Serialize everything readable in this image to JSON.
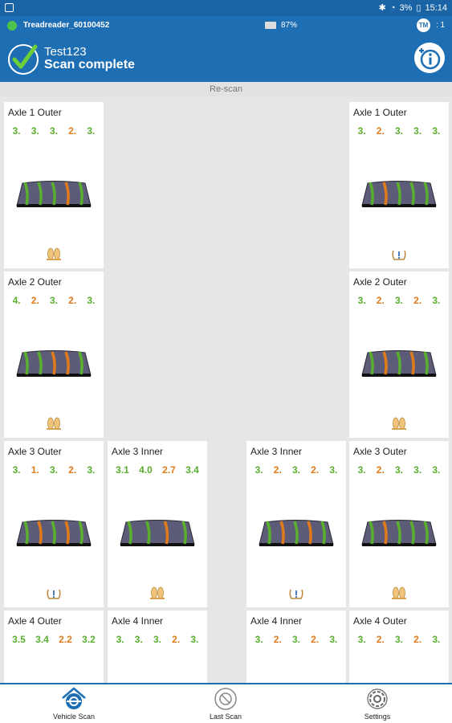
{
  "statusbar": {
    "battery": "3%",
    "time": "15:14"
  },
  "device": {
    "name": "Treadreader_60100452",
    "battery": "87%",
    "tm_badge": "TM",
    "tm_count": ": 1"
  },
  "header": {
    "subtitle": "Test123",
    "title": "Scan complete"
  },
  "rescan_label": "Re-scan",
  "colors": {
    "primary": "#1e6eb4",
    "good": "#5aae2e",
    "warn": "#e07a1a"
  },
  "tires": [
    {
      "label": "Axle 1 Outer",
      "depths": [
        {
          "v": "3.",
          "c": "g"
        },
        {
          "v": "3.",
          "c": "g"
        },
        {
          "v": "3.",
          "c": "g"
        },
        {
          "v": "2.",
          "c": "o"
        },
        {
          "v": "3.",
          "c": "g"
        }
      ],
      "stripes": [
        "g",
        "g",
        "g",
        "o",
        "g"
      ],
      "icon": "feet-icon"
    },
    {
      "label": "Axle 1 Outer",
      "depths": [
        {
          "v": "3.",
          "c": "g"
        },
        {
          "v": "2.",
          "c": "o"
        },
        {
          "v": "3.",
          "c": "g"
        },
        {
          "v": "3.",
          "c": "g"
        },
        {
          "v": "3.",
          "c": "g"
        }
      ],
      "stripes": [
        "g",
        "o",
        "g",
        "g",
        "g"
      ],
      "icon": "pressure-icon"
    },
    {
      "label": "Axle 2 Outer",
      "depths": [
        {
          "v": "4.",
          "c": "g"
        },
        {
          "v": "2.",
          "c": "o"
        },
        {
          "v": "3.",
          "c": "g"
        },
        {
          "v": "2.",
          "c": "o"
        },
        {
          "v": "3.",
          "c": "g"
        }
      ],
      "stripes": [
        "g",
        "g",
        "o",
        "o",
        "g"
      ],
      "icon": "feet-icon"
    },
    {
      "label": "Axle 2 Outer",
      "depths": [
        {
          "v": "3.",
          "c": "g"
        },
        {
          "v": "2.",
          "c": "o"
        },
        {
          "v": "3.",
          "c": "g"
        },
        {
          "v": "2.",
          "c": "o"
        },
        {
          "v": "3.",
          "c": "g"
        }
      ],
      "stripes": [
        "g",
        "o",
        "g",
        "o",
        "g"
      ],
      "icon": "feet-icon"
    },
    {
      "label": "Axle 3 Outer",
      "depths": [
        {
          "v": "3.",
          "c": "g"
        },
        {
          "v": "1.",
          "c": "o"
        },
        {
          "v": "3.",
          "c": "g"
        },
        {
          "v": "2.",
          "c": "o"
        },
        {
          "v": "3.",
          "c": "g"
        }
      ],
      "stripes": [
        "g",
        "o",
        "g",
        "o",
        "g"
      ],
      "icon": "pressure-icon"
    },
    {
      "label": "Axle 3 Inner",
      "depths": [
        {
          "v": "3.1",
          "c": "g"
        },
        {
          "v": "4.0",
          "c": "g"
        },
        {
          "v": "2.7",
          "c": "o"
        },
        {
          "v": "3.4",
          "c": "g"
        }
      ],
      "stripes": [
        "g",
        "g",
        "o",
        "g"
      ],
      "icon": "feet-icon"
    },
    {
      "label": "Axle 3 Inner",
      "depths": [
        {
          "v": "3.",
          "c": "g"
        },
        {
          "v": "2.",
          "c": "o"
        },
        {
          "v": "3.",
          "c": "g"
        },
        {
          "v": "2.",
          "c": "o"
        },
        {
          "v": "3.",
          "c": "g"
        }
      ],
      "stripes": [
        "g",
        "o",
        "g",
        "o",
        "g"
      ],
      "icon": "pressure-icon"
    },
    {
      "label": "Axle 3 Outer",
      "depths": [
        {
          "v": "3.",
          "c": "g"
        },
        {
          "v": "2.",
          "c": "o"
        },
        {
          "v": "3.",
          "c": "g"
        },
        {
          "v": "3.",
          "c": "g"
        },
        {
          "v": "3.",
          "c": "g"
        }
      ],
      "stripes": [
        "g",
        "o",
        "g",
        "g",
        "g"
      ],
      "icon": "feet-icon"
    },
    {
      "label": "Axle 4 Outer",
      "depths": [
        {
          "v": "3.5",
          "c": "g"
        },
        {
          "v": "3.4",
          "c": "g"
        },
        {
          "v": "2.2",
          "c": "o"
        },
        {
          "v": "3.2",
          "c": "g"
        }
      ],
      "stripes": [],
      "icon": ""
    },
    {
      "label": "Axle 4 Inner",
      "depths": [
        {
          "v": "3.",
          "c": "g"
        },
        {
          "v": "3.",
          "c": "g"
        },
        {
          "v": "3.",
          "c": "g"
        },
        {
          "v": "2.",
          "c": "o"
        },
        {
          "v": "3.",
          "c": "g"
        }
      ],
      "stripes": [],
      "icon": ""
    },
    {
      "label": "Axle 4 Inner",
      "depths": [
        {
          "v": "3.",
          "c": "g"
        },
        {
          "v": "2.",
          "c": "o"
        },
        {
          "v": "3.",
          "c": "g"
        },
        {
          "v": "2.",
          "c": "o"
        },
        {
          "v": "3.",
          "c": "g"
        }
      ],
      "stripes": [],
      "icon": ""
    },
    {
      "label": "Axle 4 Outer",
      "depths": [
        {
          "v": "3.",
          "c": "g"
        },
        {
          "v": "2.",
          "c": "o"
        },
        {
          "v": "3.",
          "c": "g"
        },
        {
          "v": "2.",
          "c": "o"
        },
        {
          "v": "3.",
          "c": "g"
        }
      ],
      "stripes": [],
      "icon": ""
    }
  ],
  "nav": [
    {
      "label": "Vehicle Scan",
      "icon": "vehicle-scan-icon",
      "active": true
    },
    {
      "label": "Last Scan",
      "icon": "last-scan-icon",
      "active": false
    },
    {
      "label": "Settings",
      "icon": "settings-icon",
      "active": false
    }
  ]
}
